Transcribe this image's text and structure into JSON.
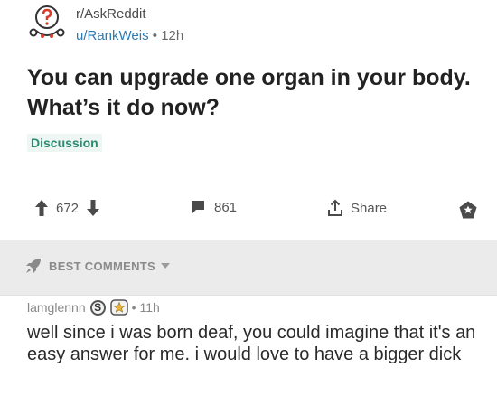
{
  "post": {
    "subreddit": "r/AskReddit",
    "author": "u/RankWeis",
    "separator": "•",
    "age": "12h",
    "title": "You can upgrade one organ in your body. What’s it do now?",
    "flair": "Discussion",
    "votes": "672",
    "comments": "861",
    "share_label": "Share"
  },
  "comments_section": {
    "sort_label": "BEST COMMENTS"
  },
  "comment": {
    "author": "lamglennn",
    "badge": "S",
    "separator": "•",
    "age": "11h",
    "body": "well since i was born deaf, you could imagine that it's an easy answer for me. i would love to have a bigger dick"
  },
  "colors": {
    "author_link": "#2f7bb0",
    "flair": "#2a8a6e",
    "best_bar_bg": "#ebebeb",
    "subreddit_icon_red": "#d93a2b"
  },
  "icons": [
    "askreddit-icon",
    "upvote-icon",
    "downvote-icon",
    "comment-icon",
    "share-icon",
    "save-icon",
    "rocket-icon",
    "chevron-down-icon",
    "award-icon"
  ]
}
